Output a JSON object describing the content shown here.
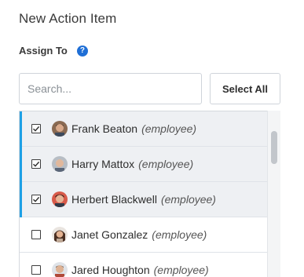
{
  "header": {
    "title": "New Action Item"
  },
  "assign": {
    "label": "Assign To",
    "help_glyph": "?"
  },
  "search": {
    "placeholder": "Search...",
    "value": ""
  },
  "select_all_label": "Select All",
  "employees": [
    {
      "name": "Frank Beaton",
      "role": "(employee)",
      "checked": true,
      "avatar": "avatar-frank"
    },
    {
      "name": "Harry Mattox",
      "role": "(employee)",
      "checked": true,
      "avatar": "avatar-harry"
    },
    {
      "name": "Herbert Blackwell",
      "role": "(employee)",
      "checked": true,
      "avatar": "avatar-herbert"
    },
    {
      "name": "Janet Gonzalez",
      "role": "(employee)",
      "checked": false,
      "avatar": "avatar-janet"
    },
    {
      "name": "Jared Houghton",
      "role": "(employee)",
      "checked": false,
      "avatar": "avatar-jared"
    }
  ],
  "colors": {
    "accent": "#1ea0e6",
    "help": "#1f6fd6",
    "selected_bg": "#eef0f3"
  }
}
